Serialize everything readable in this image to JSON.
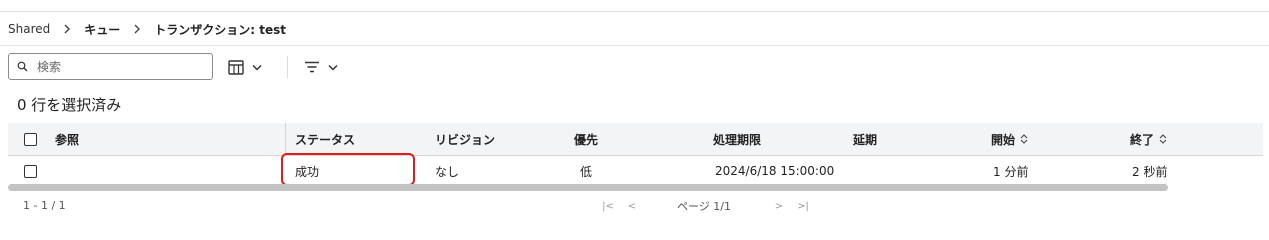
{
  "breadcrumb": {
    "root": "Shared",
    "queue": "キュー",
    "current": "トランザクション: test"
  },
  "toolbar": {
    "search_placeholder": "検索",
    "icons": [
      "search-icon",
      "table-columns-icon",
      "chevron-down-icon",
      "filter-lines-icon"
    ]
  },
  "selection": {
    "status": "0 行を選択済み"
  },
  "table": {
    "columns": [
      "参照",
      "ステータス",
      "リビジョン",
      "優先",
      "処理期限",
      "延期",
      "開始",
      "終了"
    ],
    "rows": [
      {
        "reference": "",
        "status": "成功",
        "revision": "なし",
        "priority": "低",
        "deadline": "2024/6/18 15:00:00",
        "postpone": "",
        "started": "1 分前",
        "ended": "2 秒前"
      }
    ]
  },
  "footer": {
    "range": "1 - 1 / 1",
    "page": "ページ 1/1",
    "nav": [
      "|<",
      "<",
      ">",
      ">|"
    ]
  },
  "colors": {
    "header_bg": "#f3f4f6",
    "highlight": "#e01b1b",
    "scrollbar": "#c4c4c4"
  }
}
